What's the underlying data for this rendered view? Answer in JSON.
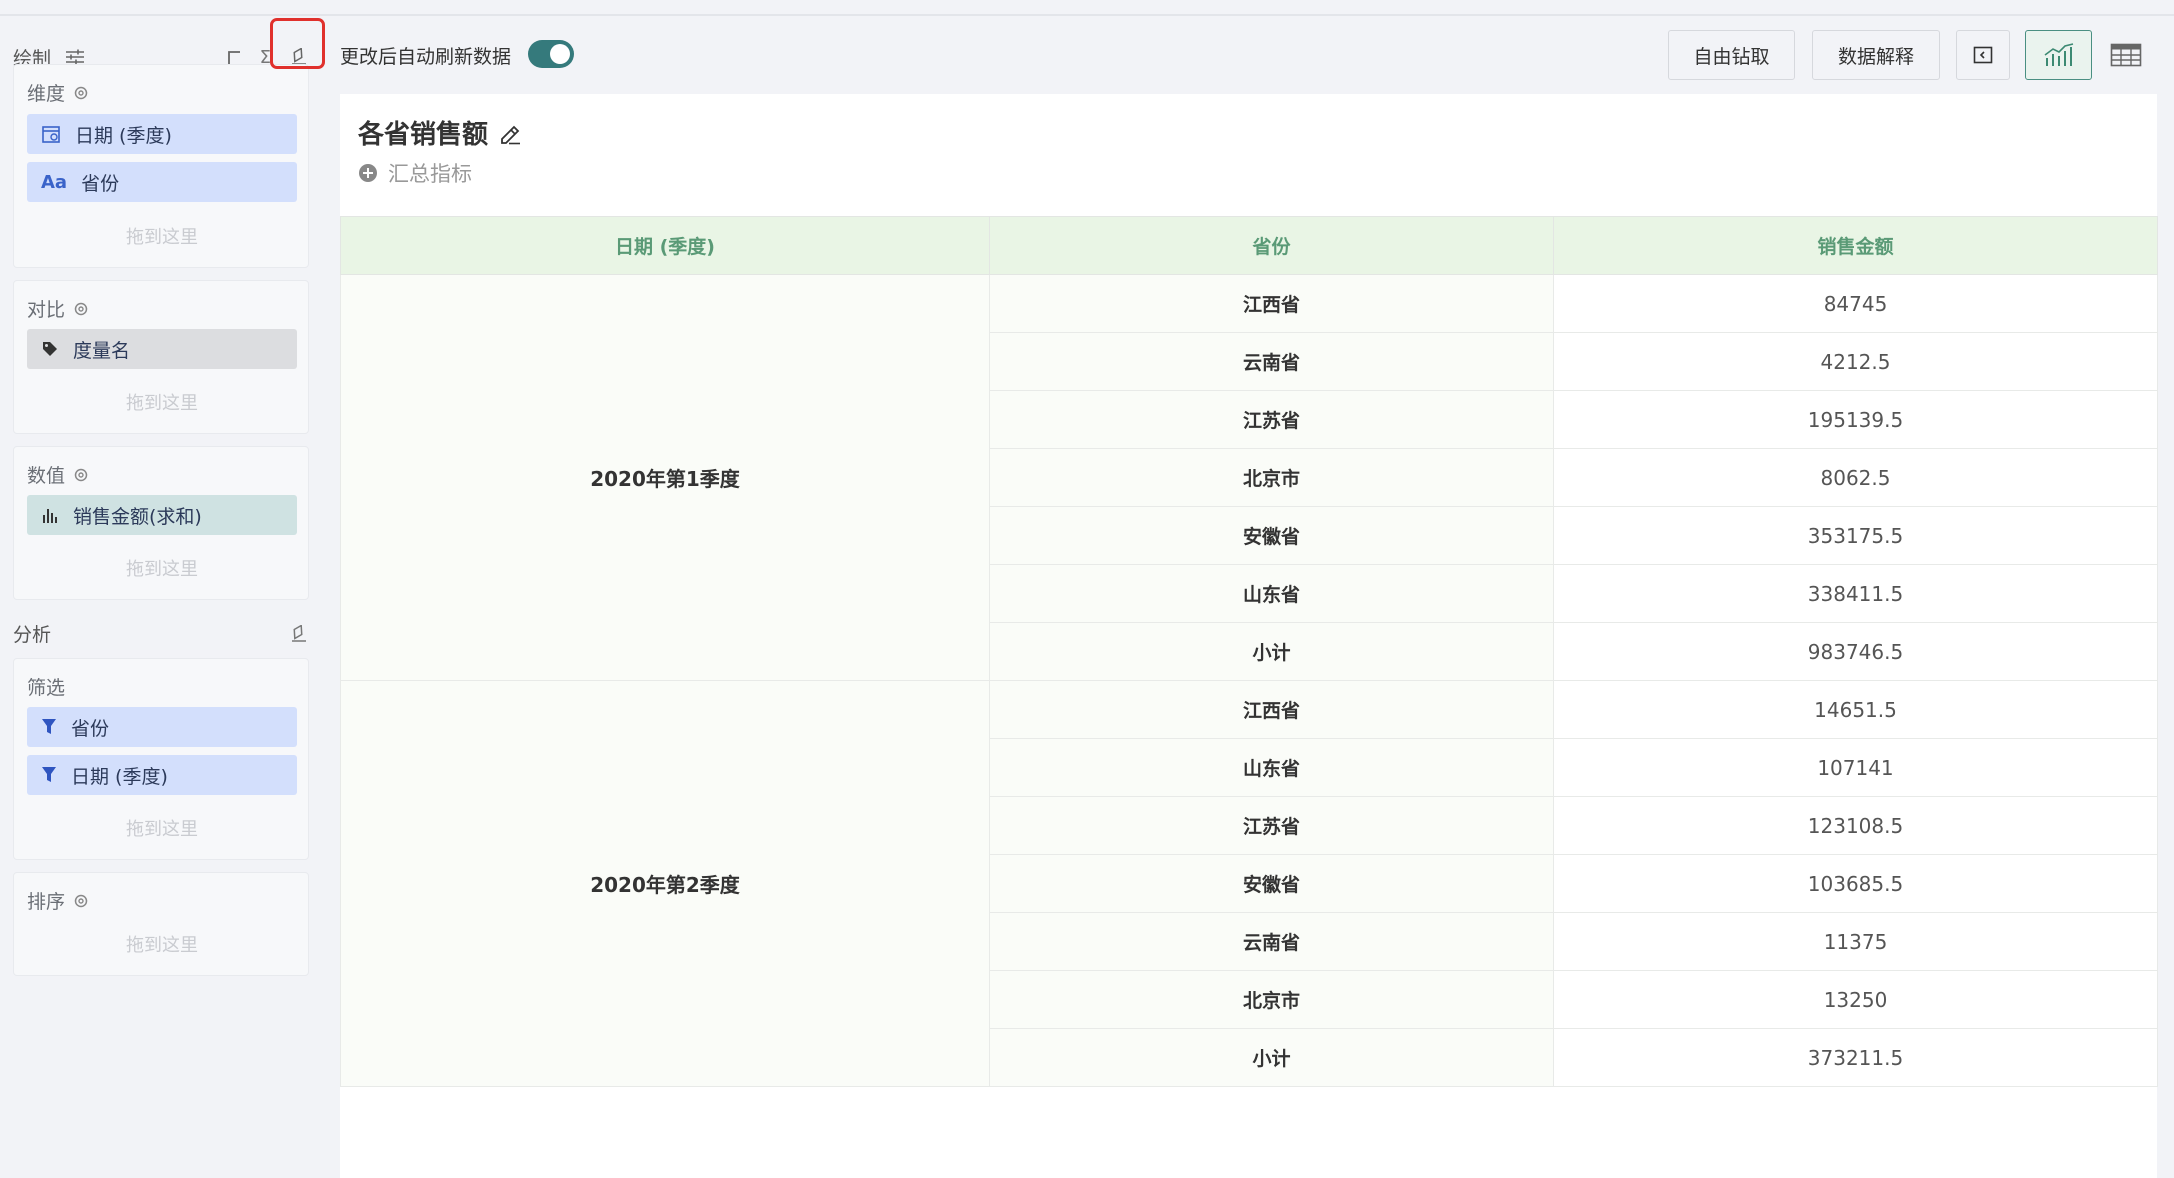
{
  "sidebar": {
    "draw_label": "绘制",
    "dimensions": {
      "title": "维度",
      "items": [
        {
          "label": "日期 (季度)",
          "icon": "calendar-icon"
        },
        {
          "label": "省份",
          "icon": "text-type-icon",
          "prefix": "Aa"
        }
      ],
      "drop_hint": "拖到这里"
    },
    "compare": {
      "title": "对比",
      "items": [
        {
          "label": "度量名",
          "icon": "tag-icon"
        }
      ],
      "drop_hint": "拖到这里"
    },
    "values": {
      "title": "数值",
      "items": [
        {
          "label": "销售金额(求和)",
          "icon": "bar-chart-icon"
        }
      ],
      "drop_hint": "拖到这里"
    },
    "analysis_label": "分析",
    "filter": {
      "title": "筛选",
      "items": [
        {
          "label": "省份",
          "icon": "filter-icon"
        },
        {
          "label": "日期 (季度)",
          "icon": "filter-icon"
        }
      ],
      "drop_hint": "拖到这里"
    },
    "sort": {
      "title": "排序",
      "drop_hint": "拖到这里"
    }
  },
  "toolbar": {
    "auto_refresh_label": "更改后自动刷新数据",
    "auto_refresh_on": true,
    "drill_label": "自由钻取",
    "explain_label": "数据解释"
  },
  "chart": {
    "title": "各省销售额",
    "add_metric_label": "汇总指标"
  },
  "table": {
    "headers": [
      "日期 (季度)",
      "省份",
      "销售金额"
    ],
    "groups": [
      {
        "quarter": "2020年第1季度",
        "rows": [
          {
            "province": "江西省",
            "value": "84745"
          },
          {
            "province": "云南省",
            "value": "4212.5"
          },
          {
            "province": "江苏省",
            "value": "195139.5"
          },
          {
            "province": "北京市",
            "value": "8062.5"
          },
          {
            "province": "安徽省",
            "value": "353175.5"
          },
          {
            "province": "山东省",
            "value": "338411.5"
          },
          {
            "province": "小计",
            "value": "983746.5"
          }
        ]
      },
      {
        "quarter": "2020年第2季度",
        "rows": [
          {
            "province": "江西省",
            "value": "14651.5"
          },
          {
            "province": "山东省",
            "value": "107141"
          },
          {
            "province": "江苏省",
            "value": "123108.5"
          },
          {
            "province": "安徽省",
            "value": "103685.5"
          },
          {
            "province": "云南省",
            "value": "11375"
          },
          {
            "province": "北京市",
            "value": "13250"
          },
          {
            "province": "小计",
            "value": "373211.5"
          }
        ]
      }
    ]
  },
  "colors": {
    "accent": "#357a7c",
    "highlight": "#e0302c",
    "header_bg": "#e9f5e5",
    "header_text": "#5a9a76"
  }
}
